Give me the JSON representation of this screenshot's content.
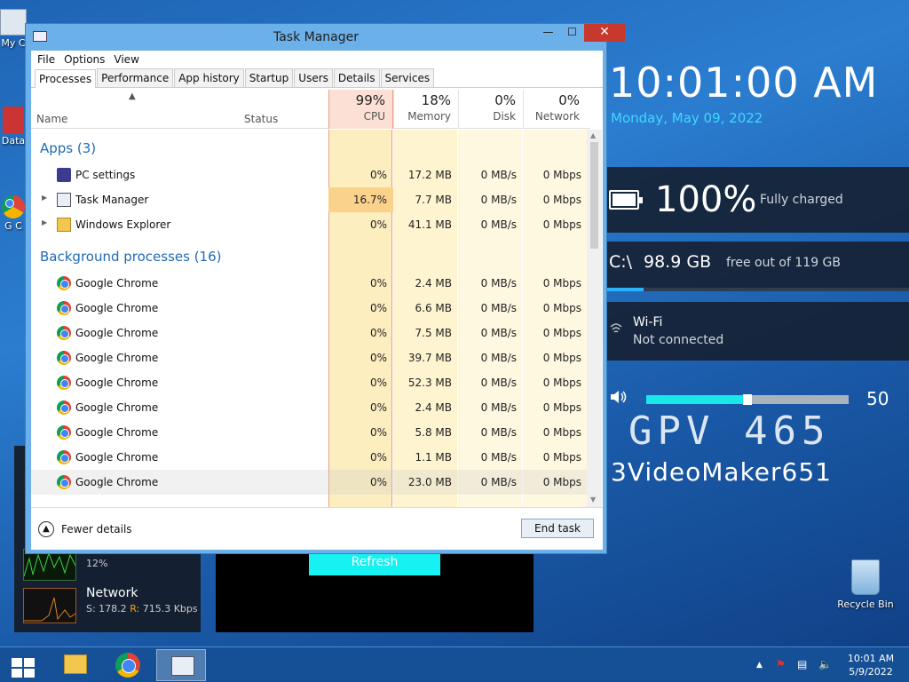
{
  "desktop": {
    "icons": [
      {
        "label": "My C"
      },
      {
        "label": "Data"
      },
      {
        "label": "G C"
      }
    ],
    "recycle_bin": "Recycle Bin"
  },
  "gadgets": {
    "clock": {
      "time": "10:01:00 AM",
      "date": "Monday, May 09, 2022"
    },
    "battery": {
      "percent": "100%",
      "status": "Fully charged",
      "level": 1.0
    },
    "drive": {
      "label": "C:\\",
      "free": "98.9 GB",
      "desc": "free out of 119 GB",
      "used_fraction": 0.17
    },
    "wifi": {
      "title": "Wi-Fi",
      "status": "Not connected"
    },
    "volume": {
      "value": "50",
      "level": 0.5
    },
    "watermark": "GPV 465",
    "channel": "3VideoMaker651",
    "refresh_label": "Refresh",
    "network": {
      "cpu_pct": "12%",
      "title": "Network",
      "send_label": "S: 178.2",
      "recv_label": "R:",
      "recv_value": "715.3 Kbps"
    }
  },
  "task_manager": {
    "title": "Task Manager",
    "menu": [
      "File",
      "Options",
      "View"
    ],
    "tabs": [
      "Processes",
      "Performance",
      "App history",
      "Startup",
      "Users",
      "Details",
      "Services"
    ],
    "active_tab": "Processes",
    "columns": {
      "name": "Name",
      "status": "Status",
      "cpu": {
        "pct": "99%",
        "label": "CPU"
      },
      "memory": {
        "pct": "18%",
        "label": "Memory"
      },
      "disk": {
        "pct": "0%",
        "label": "Disk"
      },
      "network": {
        "pct": "0%",
        "label": "Network"
      }
    },
    "groups": {
      "apps": "Apps (3)",
      "background": "Background processes (16)"
    },
    "apps": [
      {
        "name": "PC settings",
        "icon": "settings-icon",
        "cpu": "0%",
        "memory": "17.2 MB",
        "disk": "0 MB/s",
        "network": "0 Mbps",
        "expandable": false
      },
      {
        "name": "Task Manager",
        "icon": "task-manager-icon",
        "cpu": "16.7%",
        "memory": "7.7 MB",
        "disk": "0 MB/s",
        "network": "0 Mbps",
        "expandable": true
      },
      {
        "name": "Windows Explorer",
        "icon": "folder-icon",
        "cpu": "0%",
        "memory": "41.1 MB",
        "disk": "0 MB/s",
        "network": "0 Mbps",
        "expandable": true
      }
    ],
    "background": [
      {
        "name": "Google Chrome",
        "cpu": "0%",
        "memory": "2.4 MB",
        "disk": "0 MB/s",
        "network": "0 Mbps"
      },
      {
        "name": "Google Chrome",
        "cpu": "0%",
        "memory": "6.6 MB",
        "disk": "0 MB/s",
        "network": "0 Mbps"
      },
      {
        "name": "Google Chrome",
        "cpu": "0%",
        "memory": "7.5 MB",
        "disk": "0 MB/s",
        "network": "0 Mbps"
      },
      {
        "name": "Google Chrome",
        "cpu": "0%",
        "memory": "39.7 MB",
        "disk": "0 MB/s",
        "network": "0 Mbps"
      },
      {
        "name": "Google Chrome",
        "cpu": "0%",
        "memory": "52.3 MB",
        "disk": "0 MB/s",
        "network": "0 Mbps"
      },
      {
        "name": "Google Chrome",
        "cpu": "0%",
        "memory": "2.4 MB",
        "disk": "0 MB/s",
        "network": "0 Mbps"
      },
      {
        "name": "Google Chrome",
        "cpu": "0%",
        "memory": "5.8 MB",
        "disk": "0 MB/s",
        "network": "0 Mbps"
      },
      {
        "name": "Google Chrome",
        "cpu": "0%",
        "memory": "1.1 MB",
        "disk": "0 MB/s",
        "network": "0 Mbps"
      },
      {
        "name": "Google Chrome",
        "cpu": "0%",
        "memory": "23.0 MB",
        "disk": "0 MB/s",
        "network": "0 Mbps"
      }
    ],
    "fewer_details": "Fewer details",
    "end_task": "End task"
  },
  "taskbar": {
    "buttons": [
      "start-icon",
      "file-explorer-icon",
      "chrome-icon",
      "task-manager-icon"
    ],
    "clock_time": "10:01 AM",
    "clock_date": "5/9/2022"
  },
  "colors": {
    "accent": "#1f6bb5",
    "cpu_highlight": "#fce0d5",
    "chart_cyan": "#18e8e8"
  }
}
